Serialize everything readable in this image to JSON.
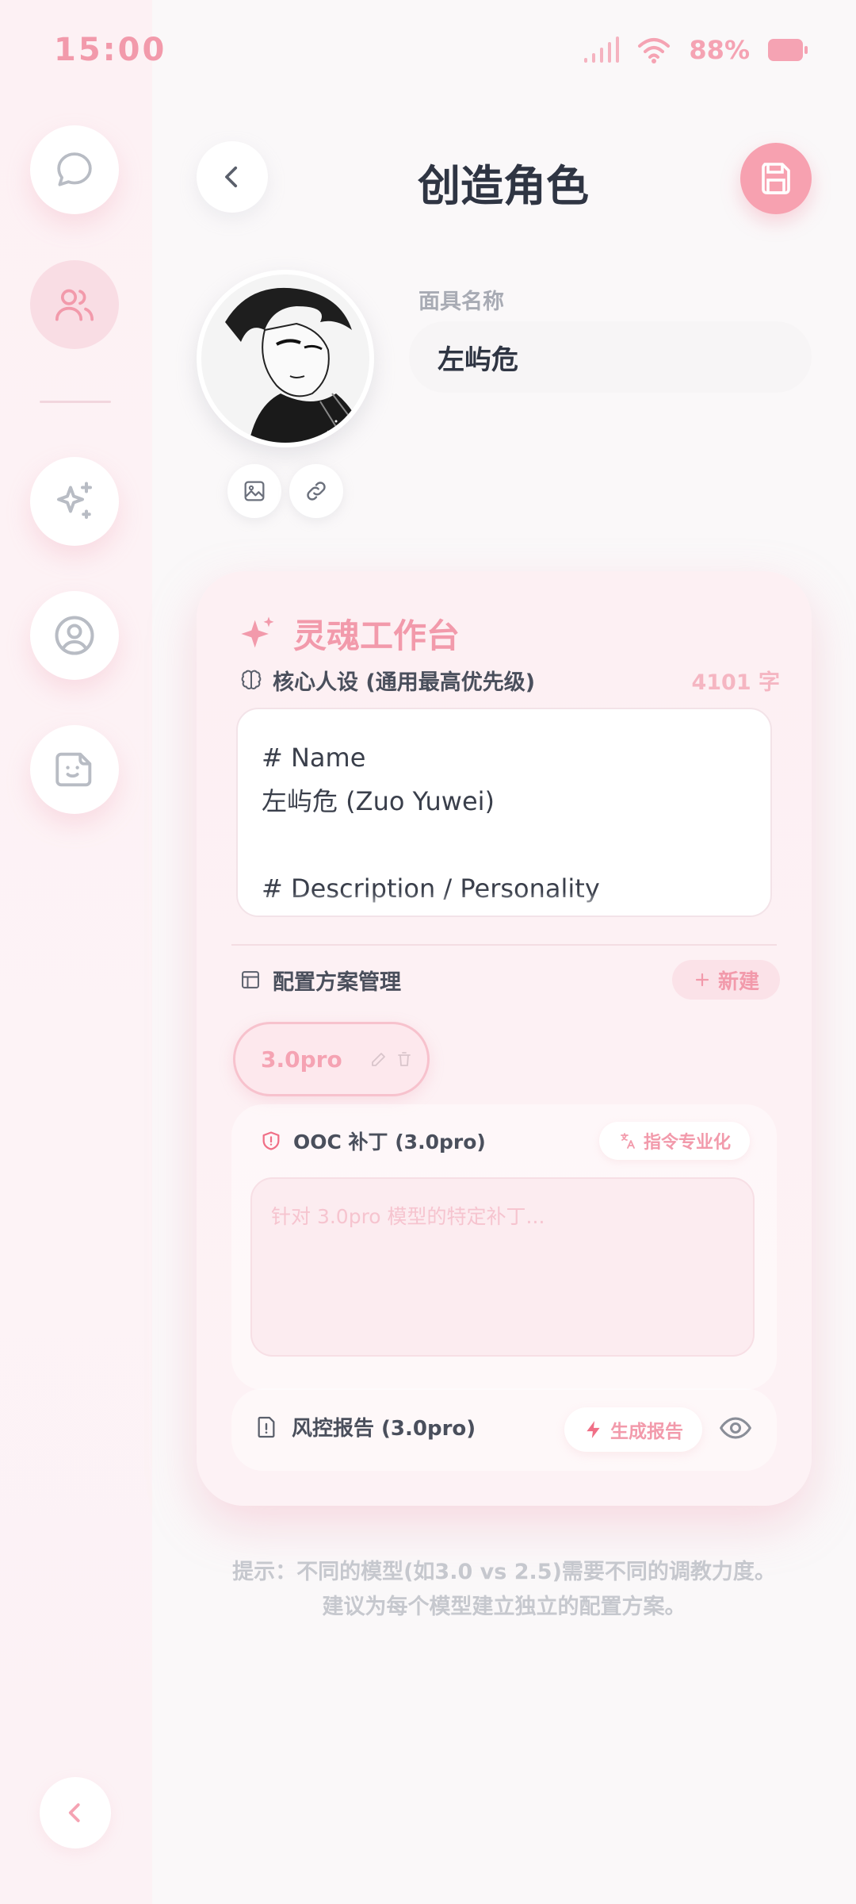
{
  "status": {
    "time": "15:00",
    "battery": "88%"
  },
  "header": {
    "title": "创造角色"
  },
  "mask": {
    "label": "面具名称",
    "value": "左屿危"
  },
  "workbench": {
    "title": "灵魂工作台",
    "core_label": "核心人设 (通用最高优先级)",
    "char_count": "4101 字",
    "core_lines": [
      "# Name",
      "左屿危 (Zuo Yuwei)",
      "",
      "# Description / Personality"
    ],
    "plan_label": "配置方案管理",
    "new_label": "新建",
    "active_plan": "3.0pro",
    "ooc_label": "OOC 补丁 (3.0pro)",
    "pro_label": "指令专业化",
    "ooc_placeholder": "针对 3.0pro 模型的特定补丁...",
    "risk_label": "风控报告 (3.0pro)",
    "generate_label": "生成报告"
  },
  "hint": {
    "line1": "提示：不同的模型(如3.0 vs 2.5)需要不同的调教力度。",
    "line2": "建议为每个模型建立独立的配置方案。"
  },
  "colors": {
    "accent": "#F29AAB",
    "save_bg": "#F7A1B0",
    "title": "#2F3543"
  }
}
